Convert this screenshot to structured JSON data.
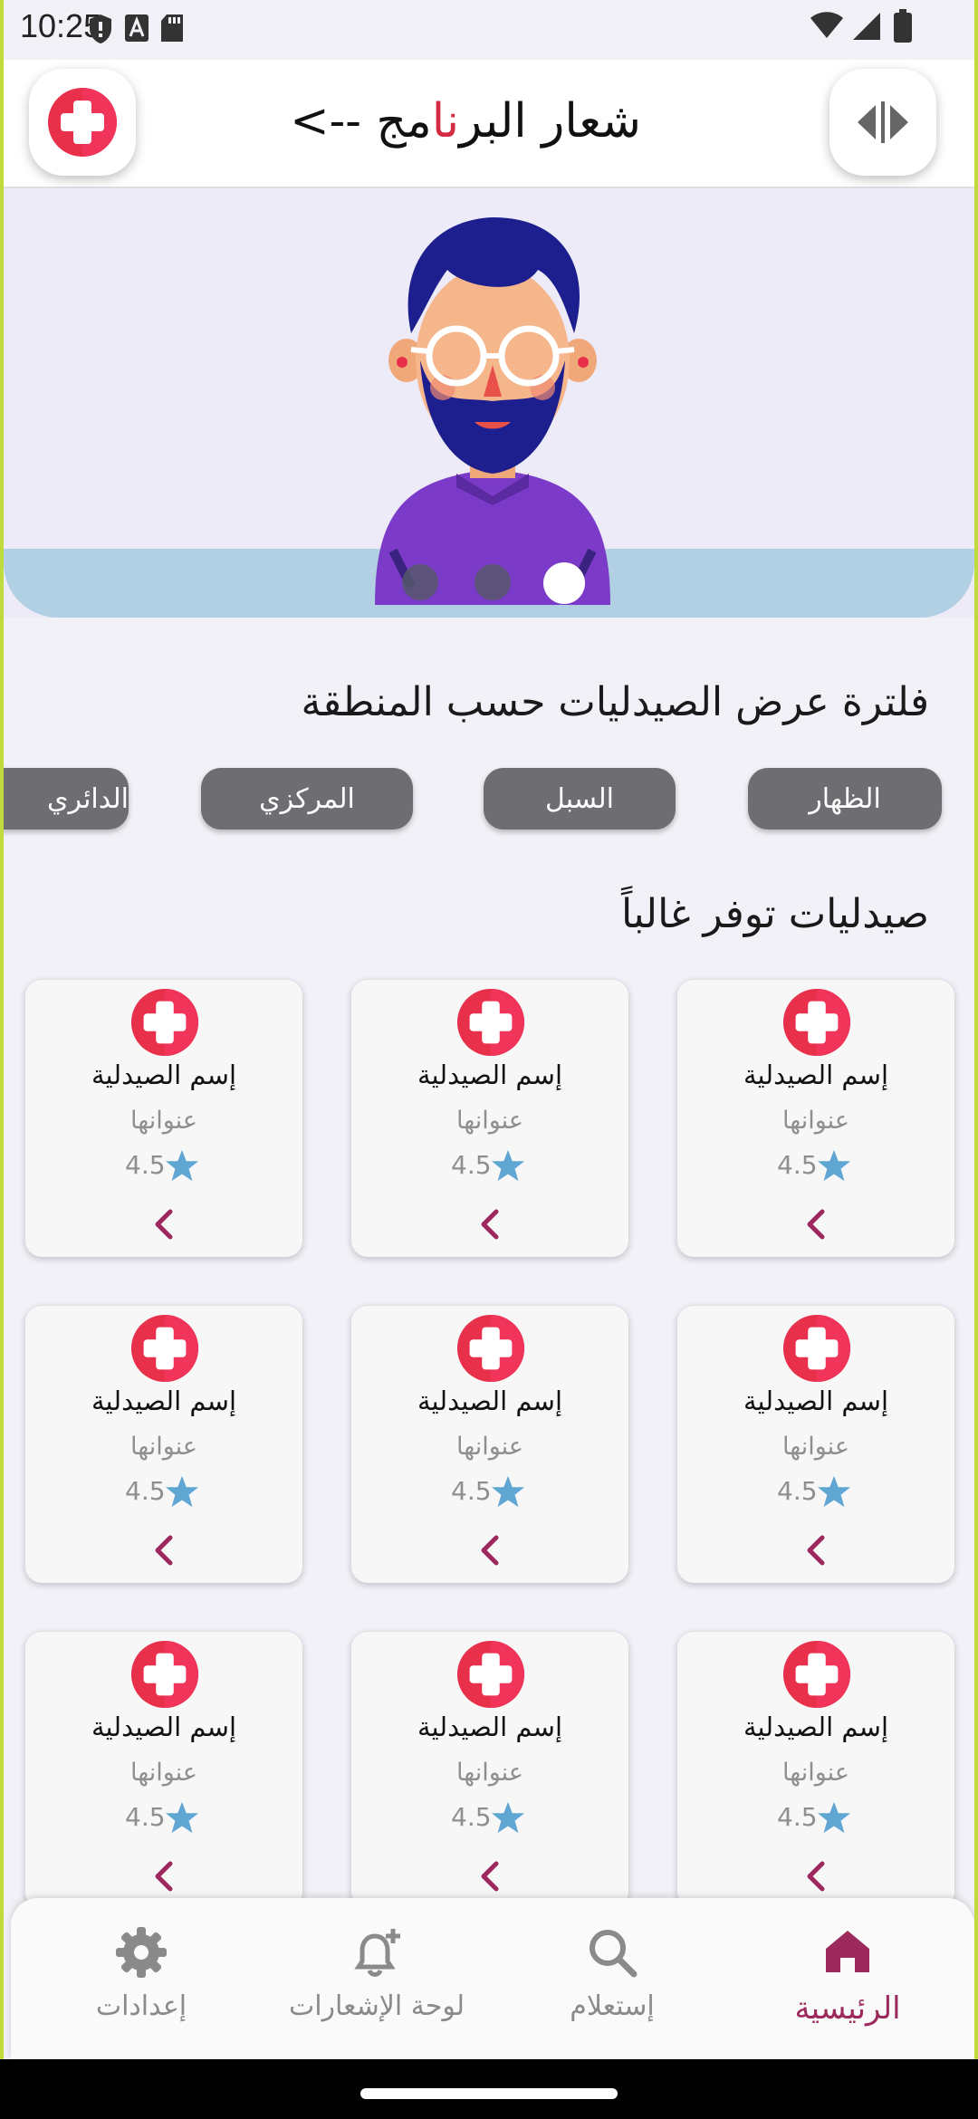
{
  "status_bar": {
    "time": "10:25"
  },
  "header": {
    "title_main": "شعار البر",
    "title_accent": "نا",
    "title_end": "مج -->"
  },
  "filter": {
    "title": "فلترة عرض الصيدليات حسب المنطقة",
    "chips": [
      "الظهار",
      "السبل",
      "المركزي",
      "الدائري"
    ]
  },
  "pharmacies": {
    "title": "صيدليات توفر غالباً",
    "cards": [
      {
        "name": "إسم الصيدلية",
        "address": "عنوانها",
        "rating": "4.5"
      },
      {
        "name": "إسم الصيدلية",
        "address": "عنوانها",
        "rating": "4.5"
      },
      {
        "name": "إسم الصيدلية",
        "address": "عنوانها",
        "rating": "4.5"
      },
      {
        "name": "إسم الصيدلية",
        "address": "عنوانها",
        "rating": "4.5"
      },
      {
        "name": "إسم الصيدلية",
        "address": "عنوانها",
        "rating": "4.5"
      },
      {
        "name": "إسم الصيدلية",
        "address": "عنوانها",
        "rating": "4.5"
      },
      {
        "name": "إسم الصيدلية",
        "address": "عنوانها",
        "rating": "4.5"
      },
      {
        "name": "إسم الصيدلية",
        "address": "عنوانها",
        "rating": "4.5"
      },
      {
        "name": "إسم الصيدلية",
        "address": "عنوانها",
        "rating": "4.5"
      }
    ]
  },
  "bottom_nav": {
    "home": "الرئيسية",
    "search": "إستعلام",
    "notifications": "لوحة الإشعارات",
    "settings": "إعدادات"
  },
  "colors": {
    "brand_red": "#e8304a",
    "active_nav": "#9d2a5c",
    "star_blue": "#5fa6d3",
    "chip_grey": "#6e6d72"
  },
  "carousel": {
    "slide_count": 3,
    "active_slide": 3
  }
}
